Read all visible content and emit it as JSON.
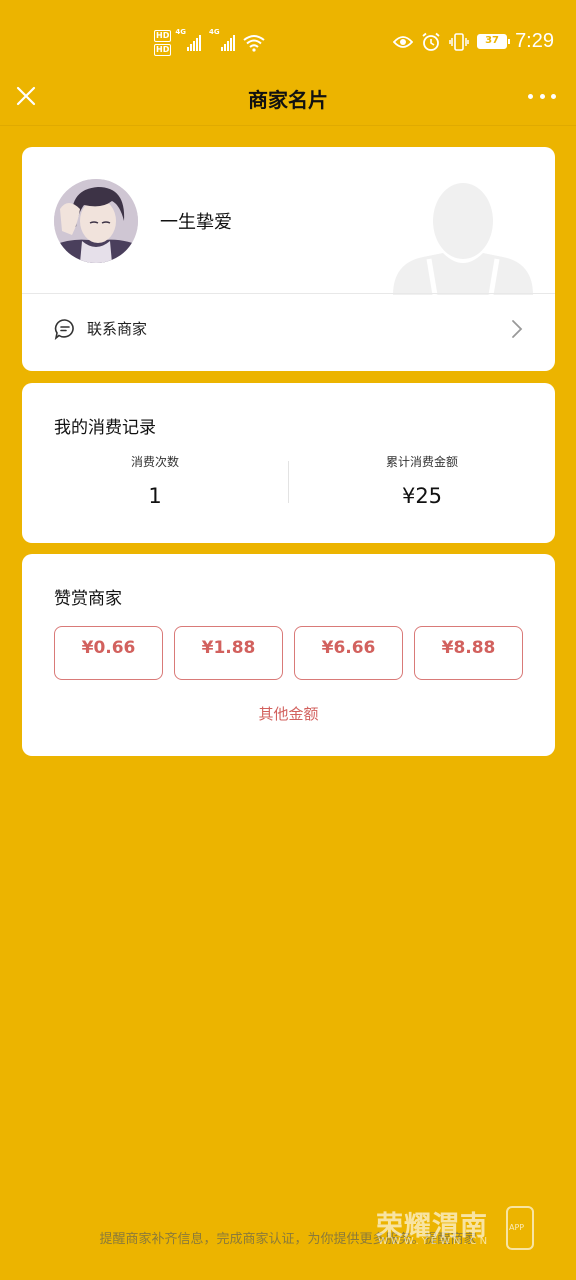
{
  "status_bar": {
    "hd_1": "HD",
    "hd_2": "HD",
    "net_1": "4G",
    "net_2": "4G",
    "battery": "37",
    "time": "7:29",
    "icons": [
      "signal-icon",
      "wifi-icon",
      "eye-icon",
      "alarm-icon",
      "vibrate-icon",
      "battery-icon"
    ]
  },
  "nav": {
    "title": "商家名片",
    "close_icon": "close-icon",
    "more_icon": "more-icon"
  },
  "profile": {
    "name": "一生挚爱",
    "contact_label": "联系商家"
  },
  "record": {
    "title": "我的消费记录",
    "count_label": "消费次数",
    "count_value": "1",
    "total_label": "累计消费金额",
    "total_value": "¥25"
  },
  "reward": {
    "title": "赞赏商家",
    "amounts": [
      "¥0.66",
      "¥1.88",
      "¥6.66",
      "¥8.88"
    ],
    "other_label": "其他金额"
  },
  "footer": {
    "text": "提醒商家补齐信息，完成商家认证，为你提供更多服务。",
    "link": "提醒商家"
  },
  "watermark": {
    "brand": "荣耀渭南",
    "site": "WWW.YEWN.CN",
    "app": "APP"
  },
  "colors": {
    "background": "#ECB400",
    "accent_red": "#D2615E",
    "card": "#FFFFFF"
  }
}
